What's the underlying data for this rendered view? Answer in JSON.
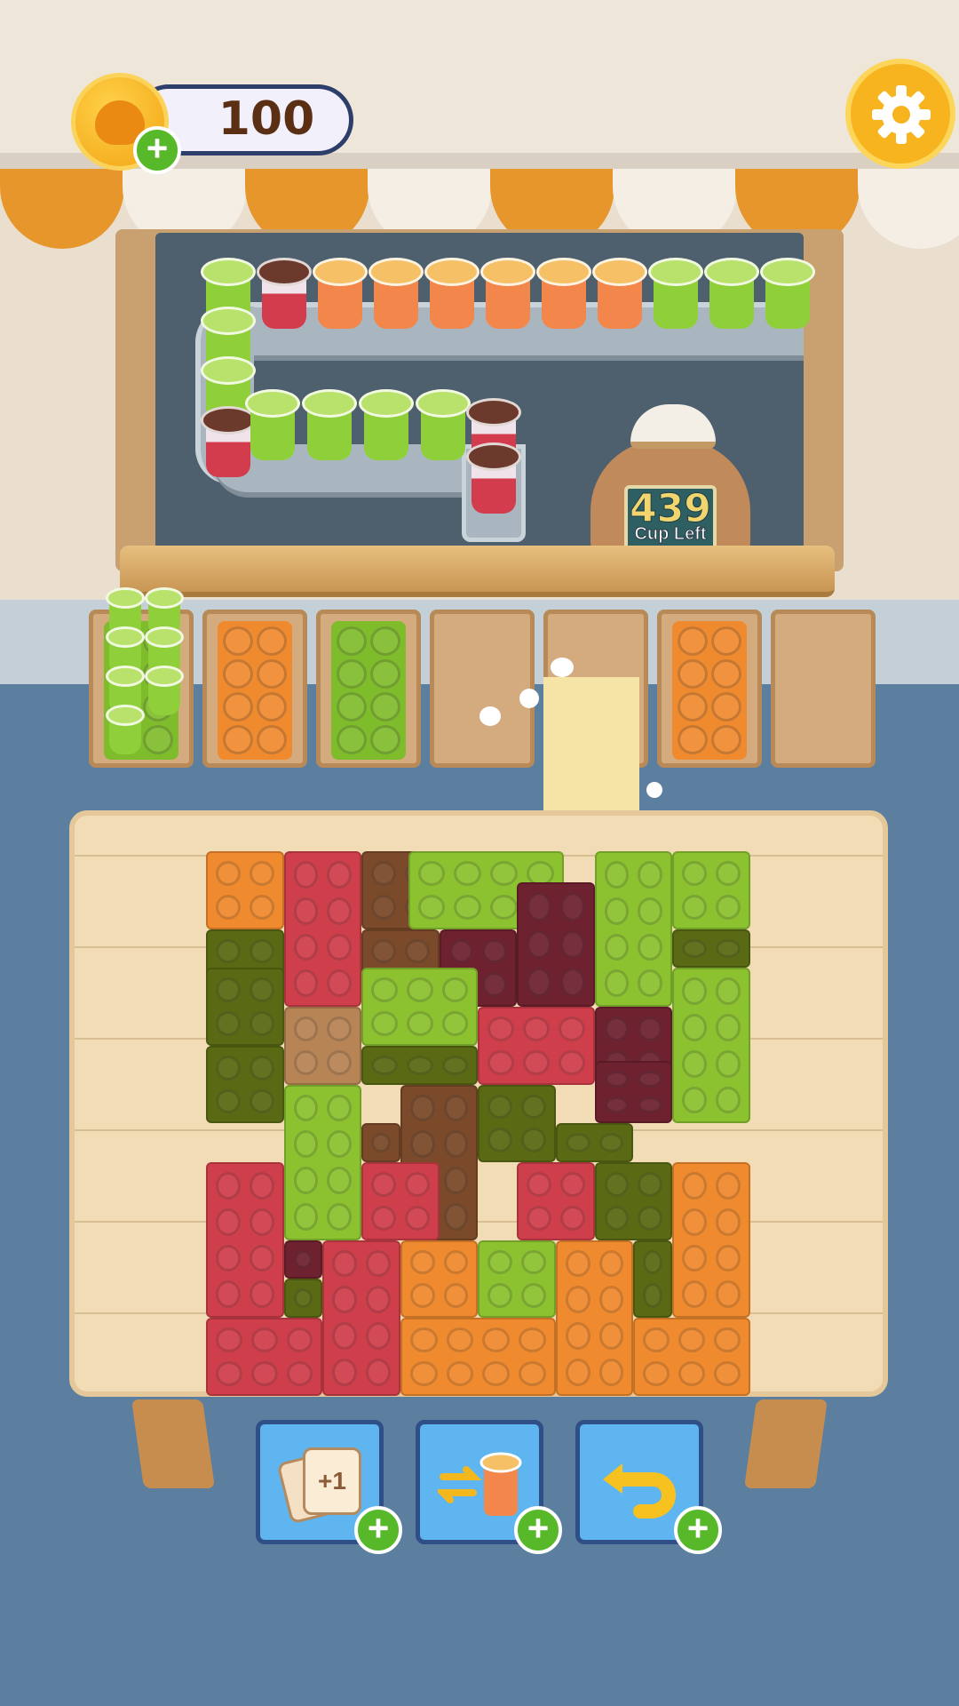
{
  "hud": {
    "coins": "100",
    "cups_left": "439",
    "cups_left_label": "Cup Left"
  },
  "powerups": {
    "add_slot_label": "+1"
  },
  "icons": {
    "coin": "capybara-coin-icon",
    "add": "plus-icon",
    "settings": "gear-icon",
    "add_slot": "plus-one-cards-icon",
    "swap": "swap-cup-icon",
    "undo": "undo-arrow-icon"
  },
  "colors": {
    "green": "#8cc230",
    "orange": "#f08a2e",
    "red": "#cf3f4b",
    "brown": "#b78456",
    "dark_green": "#5a6a14",
    "dark_red": "#6e2230",
    "dark_brown": "#7a4a2a"
  },
  "conveyor": {
    "top_row": [
      "green",
      "red",
      "orange",
      "orange",
      "orange",
      "orange",
      "orange",
      "orange",
      "green",
      "green",
      "green"
    ],
    "left_column": [
      "green",
      "green",
      "red"
    ],
    "bottom_row": [
      "green",
      "green",
      "green",
      "green"
    ],
    "drop": [
      "red",
      "red"
    ]
  },
  "slots": [
    {
      "brick": "green",
      "cups": 7
    },
    {
      "brick": "orange",
      "cups": 0
    },
    {
      "brick": "green",
      "cups": 0
    },
    {
      "brick": "empty",
      "cups": 0
    },
    {
      "brick": "empty",
      "cups": 0
    },
    {
      "brick": "orange",
      "cups": 0
    },
    {
      "brick": "empty",
      "cups": 0
    }
  ]
}
